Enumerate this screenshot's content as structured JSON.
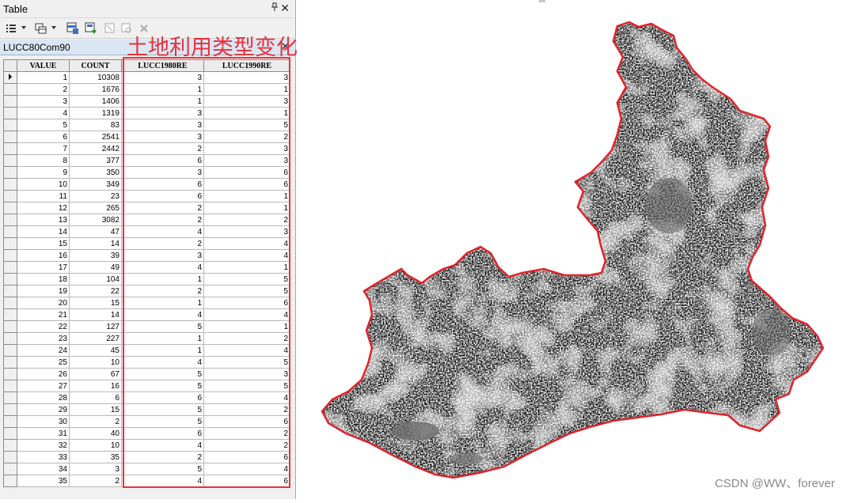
{
  "window": {
    "title": "Table",
    "pin_glyph": "📌",
    "close_glyph": "✕"
  },
  "toolbar": {
    "icons": [
      "table-options-icon",
      "related-tables-icon",
      "select-by-attributes-icon",
      "switch-selection-icon",
      "clear-selection-icon",
      "zoom-to-selected-icon",
      "delete-selected-icon"
    ]
  },
  "tab": {
    "label": "LUCC80Com90",
    "close_glyph": "✕"
  },
  "annotation": "土地利用类型变化",
  "colors": {
    "highlight": "#e8313a",
    "map_outline": "#e0232b"
  },
  "table": {
    "columns": [
      "VALUE",
      "COUNT",
      "LUCC1980RE",
      "LUCC1990RE"
    ],
    "rows": [
      [
        "1",
        "10308",
        "3",
        "3"
      ],
      [
        "2",
        "1676",
        "1",
        "1"
      ],
      [
        "3",
        "1406",
        "1",
        "3"
      ],
      [
        "4",
        "1319",
        "3",
        "1"
      ],
      [
        "5",
        "83",
        "3",
        "5"
      ],
      [
        "6",
        "2541",
        "3",
        "2"
      ],
      [
        "7",
        "2442",
        "2",
        "3"
      ],
      [
        "8",
        "377",
        "6",
        "3"
      ],
      [
        "9",
        "350",
        "3",
        "6"
      ],
      [
        "10",
        "349",
        "6",
        "6"
      ],
      [
        "11",
        "23",
        "6",
        "1"
      ],
      [
        "12",
        "265",
        "2",
        "1"
      ],
      [
        "13",
        "3082",
        "2",
        "2"
      ],
      [
        "14",
        "47",
        "4",
        "3"
      ],
      [
        "15",
        "14",
        "2",
        "4"
      ],
      [
        "16",
        "39",
        "3",
        "4"
      ],
      [
        "17",
        "49",
        "4",
        "1"
      ],
      [
        "18",
        "104",
        "1",
        "5"
      ],
      [
        "19",
        "22",
        "2",
        "5"
      ],
      [
        "20",
        "15",
        "1",
        "6"
      ],
      [
        "21",
        "14",
        "4",
        "4"
      ],
      [
        "22",
        "127",
        "5",
        "1"
      ],
      [
        "23",
        "227",
        "1",
        "2"
      ],
      [
        "24",
        "45",
        "1",
        "4"
      ],
      [
        "25",
        "10",
        "4",
        "5"
      ],
      [
        "26",
        "67",
        "5",
        "3"
      ],
      [
        "27",
        "16",
        "5",
        "5"
      ],
      [
        "28",
        "6",
        "6",
        "4"
      ],
      [
        "29",
        "15",
        "5",
        "2"
      ],
      [
        "30",
        "2",
        "5",
        "6"
      ],
      [
        "31",
        "40",
        "6",
        "2"
      ],
      [
        "32",
        "10",
        "4",
        "2"
      ],
      [
        "33",
        "35",
        "2",
        "6"
      ],
      [
        "34",
        "3",
        "5",
        "4"
      ],
      [
        "35",
        "2",
        "4",
        "6"
      ]
    ]
  },
  "watermark": "CSDN @WW、forever"
}
